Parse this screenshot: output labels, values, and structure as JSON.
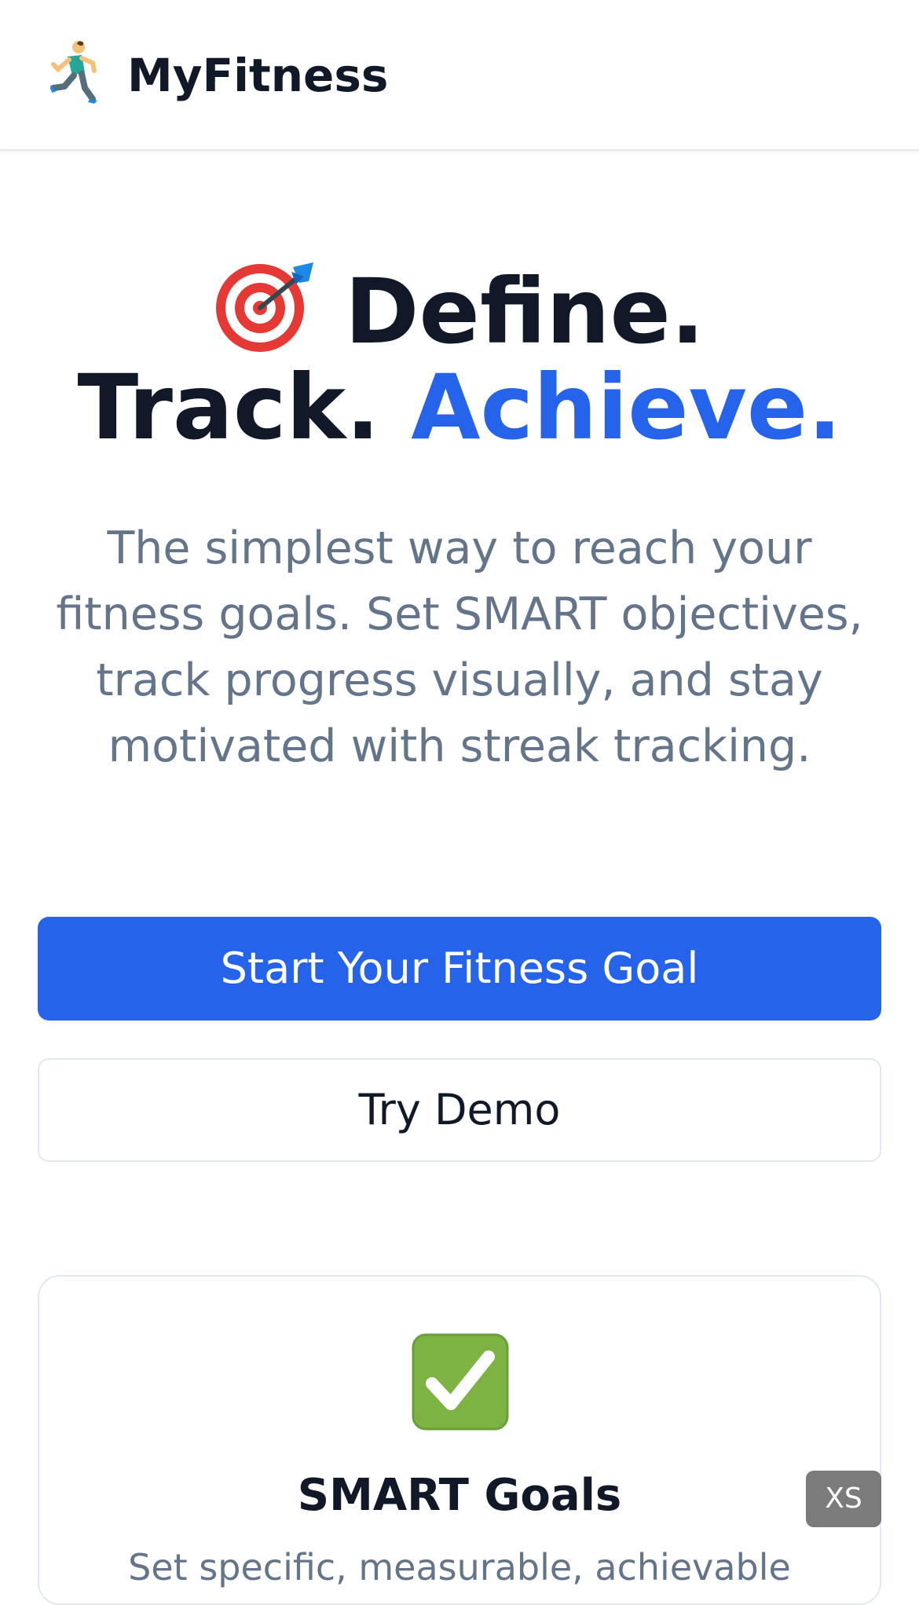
{
  "header": {
    "logo_icon": "person-running-icon",
    "title": "MyFitness"
  },
  "hero": {
    "icon": "target-dart-icon",
    "title_part1": "Define.",
    "title_part2": "Track.",
    "title_accent": "Achieve.",
    "subtitle": "The simplest way to reach your fitness goals. Set SMART objectives, track progress visually, and stay motivated with streak tracking."
  },
  "actions": {
    "primary_label": "Start Your Fitness Goal",
    "secondary_label": "Try Demo"
  },
  "features": [
    {
      "icon": "check-mark-icon",
      "title": "SMART Goals",
      "description": "Set specific, measurable, achievable"
    }
  ],
  "badge": {
    "label": "XS"
  },
  "colors": {
    "accent": "#2563eb",
    "text_dark": "#111827",
    "text_muted": "#64748b",
    "border": "#e2e8f0",
    "check_green": "#7cb342"
  }
}
